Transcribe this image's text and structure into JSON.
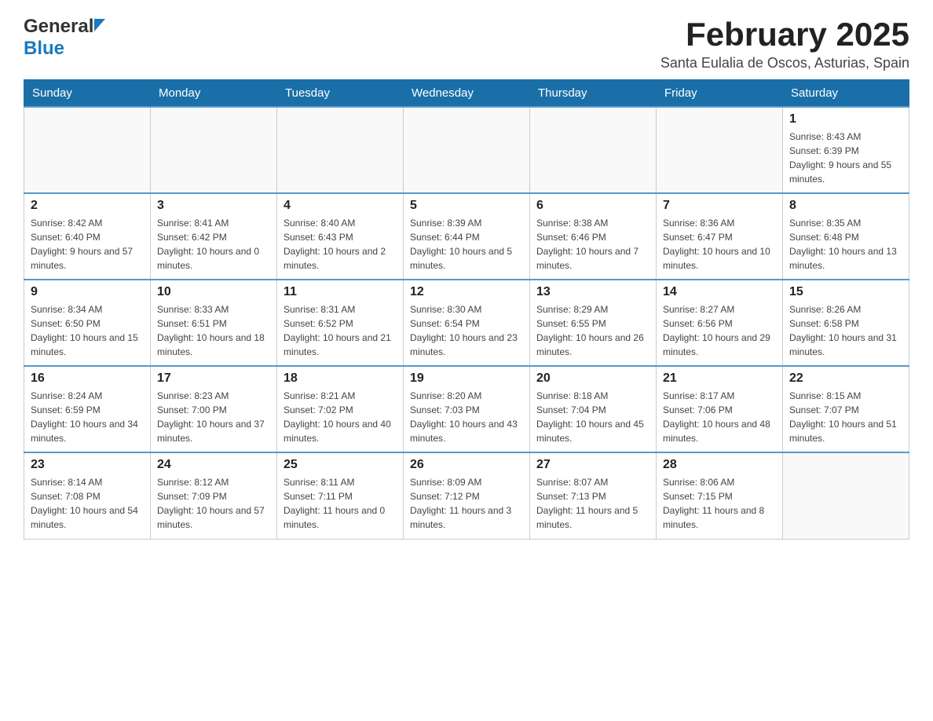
{
  "header": {
    "logo_general": "General",
    "logo_blue": "Blue",
    "month_title": "February 2025",
    "location": "Santa Eulalia de Oscos, Asturias, Spain"
  },
  "weekdays": [
    "Sunday",
    "Monday",
    "Tuesday",
    "Wednesday",
    "Thursday",
    "Friday",
    "Saturday"
  ],
  "weeks": [
    {
      "days": [
        {
          "date": "",
          "info": ""
        },
        {
          "date": "",
          "info": ""
        },
        {
          "date": "",
          "info": ""
        },
        {
          "date": "",
          "info": ""
        },
        {
          "date": "",
          "info": ""
        },
        {
          "date": "",
          "info": ""
        },
        {
          "date": "1",
          "info": "Sunrise: 8:43 AM\nSunset: 6:39 PM\nDaylight: 9 hours and 55 minutes."
        }
      ]
    },
    {
      "days": [
        {
          "date": "2",
          "info": "Sunrise: 8:42 AM\nSunset: 6:40 PM\nDaylight: 9 hours and 57 minutes."
        },
        {
          "date": "3",
          "info": "Sunrise: 8:41 AM\nSunset: 6:42 PM\nDaylight: 10 hours and 0 minutes."
        },
        {
          "date": "4",
          "info": "Sunrise: 8:40 AM\nSunset: 6:43 PM\nDaylight: 10 hours and 2 minutes."
        },
        {
          "date": "5",
          "info": "Sunrise: 8:39 AM\nSunset: 6:44 PM\nDaylight: 10 hours and 5 minutes."
        },
        {
          "date": "6",
          "info": "Sunrise: 8:38 AM\nSunset: 6:46 PM\nDaylight: 10 hours and 7 minutes."
        },
        {
          "date": "7",
          "info": "Sunrise: 8:36 AM\nSunset: 6:47 PM\nDaylight: 10 hours and 10 minutes."
        },
        {
          "date": "8",
          "info": "Sunrise: 8:35 AM\nSunset: 6:48 PM\nDaylight: 10 hours and 13 minutes."
        }
      ]
    },
    {
      "days": [
        {
          "date": "9",
          "info": "Sunrise: 8:34 AM\nSunset: 6:50 PM\nDaylight: 10 hours and 15 minutes."
        },
        {
          "date": "10",
          "info": "Sunrise: 8:33 AM\nSunset: 6:51 PM\nDaylight: 10 hours and 18 minutes."
        },
        {
          "date": "11",
          "info": "Sunrise: 8:31 AM\nSunset: 6:52 PM\nDaylight: 10 hours and 21 minutes."
        },
        {
          "date": "12",
          "info": "Sunrise: 8:30 AM\nSunset: 6:54 PM\nDaylight: 10 hours and 23 minutes."
        },
        {
          "date": "13",
          "info": "Sunrise: 8:29 AM\nSunset: 6:55 PM\nDaylight: 10 hours and 26 minutes."
        },
        {
          "date": "14",
          "info": "Sunrise: 8:27 AM\nSunset: 6:56 PM\nDaylight: 10 hours and 29 minutes."
        },
        {
          "date": "15",
          "info": "Sunrise: 8:26 AM\nSunset: 6:58 PM\nDaylight: 10 hours and 31 minutes."
        }
      ]
    },
    {
      "days": [
        {
          "date": "16",
          "info": "Sunrise: 8:24 AM\nSunset: 6:59 PM\nDaylight: 10 hours and 34 minutes."
        },
        {
          "date": "17",
          "info": "Sunrise: 8:23 AM\nSunset: 7:00 PM\nDaylight: 10 hours and 37 minutes."
        },
        {
          "date": "18",
          "info": "Sunrise: 8:21 AM\nSunset: 7:02 PM\nDaylight: 10 hours and 40 minutes."
        },
        {
          "date": "19",
          "info": "Sunrise: 8:20 AM\nSunset: 7:03 PM\nDaylight: 10 hours and 43 minutes."
        },
        {
          "date": "20",
          "info": "Sunrise: 8:18 AM\nSunset: 7:04 PM\nDaylight: 10 hours and 45 minutes."
        },
        {
          "date": "21",
          "info": "Sunrise: 8:17 AM\nSunset: 7:06 PM\nDaylight: 10 hours and 48 minutes."
        },
        {
          "date": "22",
          "info": "Sunrise: 8:15 AM\nSunset: 7:07 PM\nDaylight: 10 hours and 51 minutes."
        }
      ]
    },
    {
      "days": [
        {
          "date": "23",
          "info": "Sunrise: 8:14 AM\nSunset: 7:08 PM\nDaylight: 10 hours and 54 minutes."
        },
        {
          "date": "24",
          "info": "Sunrise: 8:12 AM\nSunset: 7:09 PM\nDaylight: 10 hours and 57 minutes."
        },
        {
          "date": "25",
          "info": "Sunrise: 8:11 AM\nSunset: 7:11 PM\nDaylight: 11 hours and 0 minutes."
        },
        {
          "date": "26",
          "info": "Sunrise: 8:09 AM\nSunset: 7:12 PM\nDaylight: 11 hours and 3 minutes."
        },
        {
          "date": "27",
          "info": "Sunrise: 8:07 AM\nSunset: 7:13 PM\nDaylight: 11 hours and 5 minutes."
        },
        {
          "date": "28",
          "info": "Sunrise: 8:06 AM\nSunset: 7:15 PM\nDaylight: 11 hours and 8 minutes."
        },
        {
          "date": "",
          "info": ""
        }
      ]
    }
  ]
}
